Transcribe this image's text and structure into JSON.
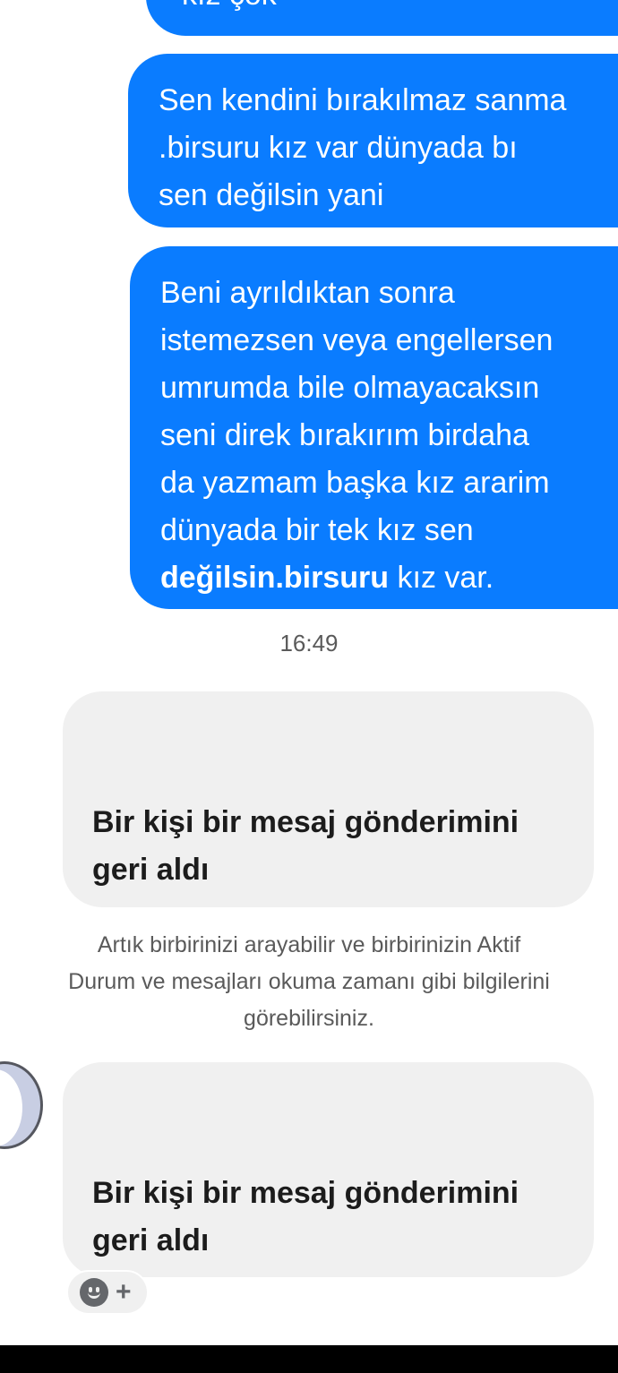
{
  "messages_out": {
    "top_partial": "kız çok",
    "bubble1": [
      "Sen kendini bırakılmaz sanma",
      ".birsuru kız var dünyada bı",
      "sen değilsin yani"
    ],
    "bubble2": [
      "Beni ayrıldıktan sonra",
      "istemezsen veya engellersen",
      "umrumda bile olmayacaksın",
      "seni direk bırakırım birdaha",
      "da yazmam başka kız ararim",
      "dünyada bir tek kız sen"
    ],
    "bubble2_last_bold": "değilsin.birsuru",
    "bubble2_last_rest": " kız var."
  },
  "timestamp": "16:49",
  "unsent_1": [
    "Bir kişi bir mesaj gönderimini",
    "geri aldı"
  ],
  "notice": [
    "Artık birbirinizi arayabilir ve birbirinizin Aktif",
    "Durum ve mesajları okuma zamanı gibi bilgilerini",
    "görebilirsiniz."
  ],
  "unsent_2": [
    "Bir kişi bir mesaj gönderimini",
    "geri aldı"
  ],
  "reaction": {
    "icon": "smiley-icon",
    "add_label": "+"
  },
  "colors": {
    "outgoing": "#0a7cff",
    "incoming": "#f0f0f0"
  }
}
